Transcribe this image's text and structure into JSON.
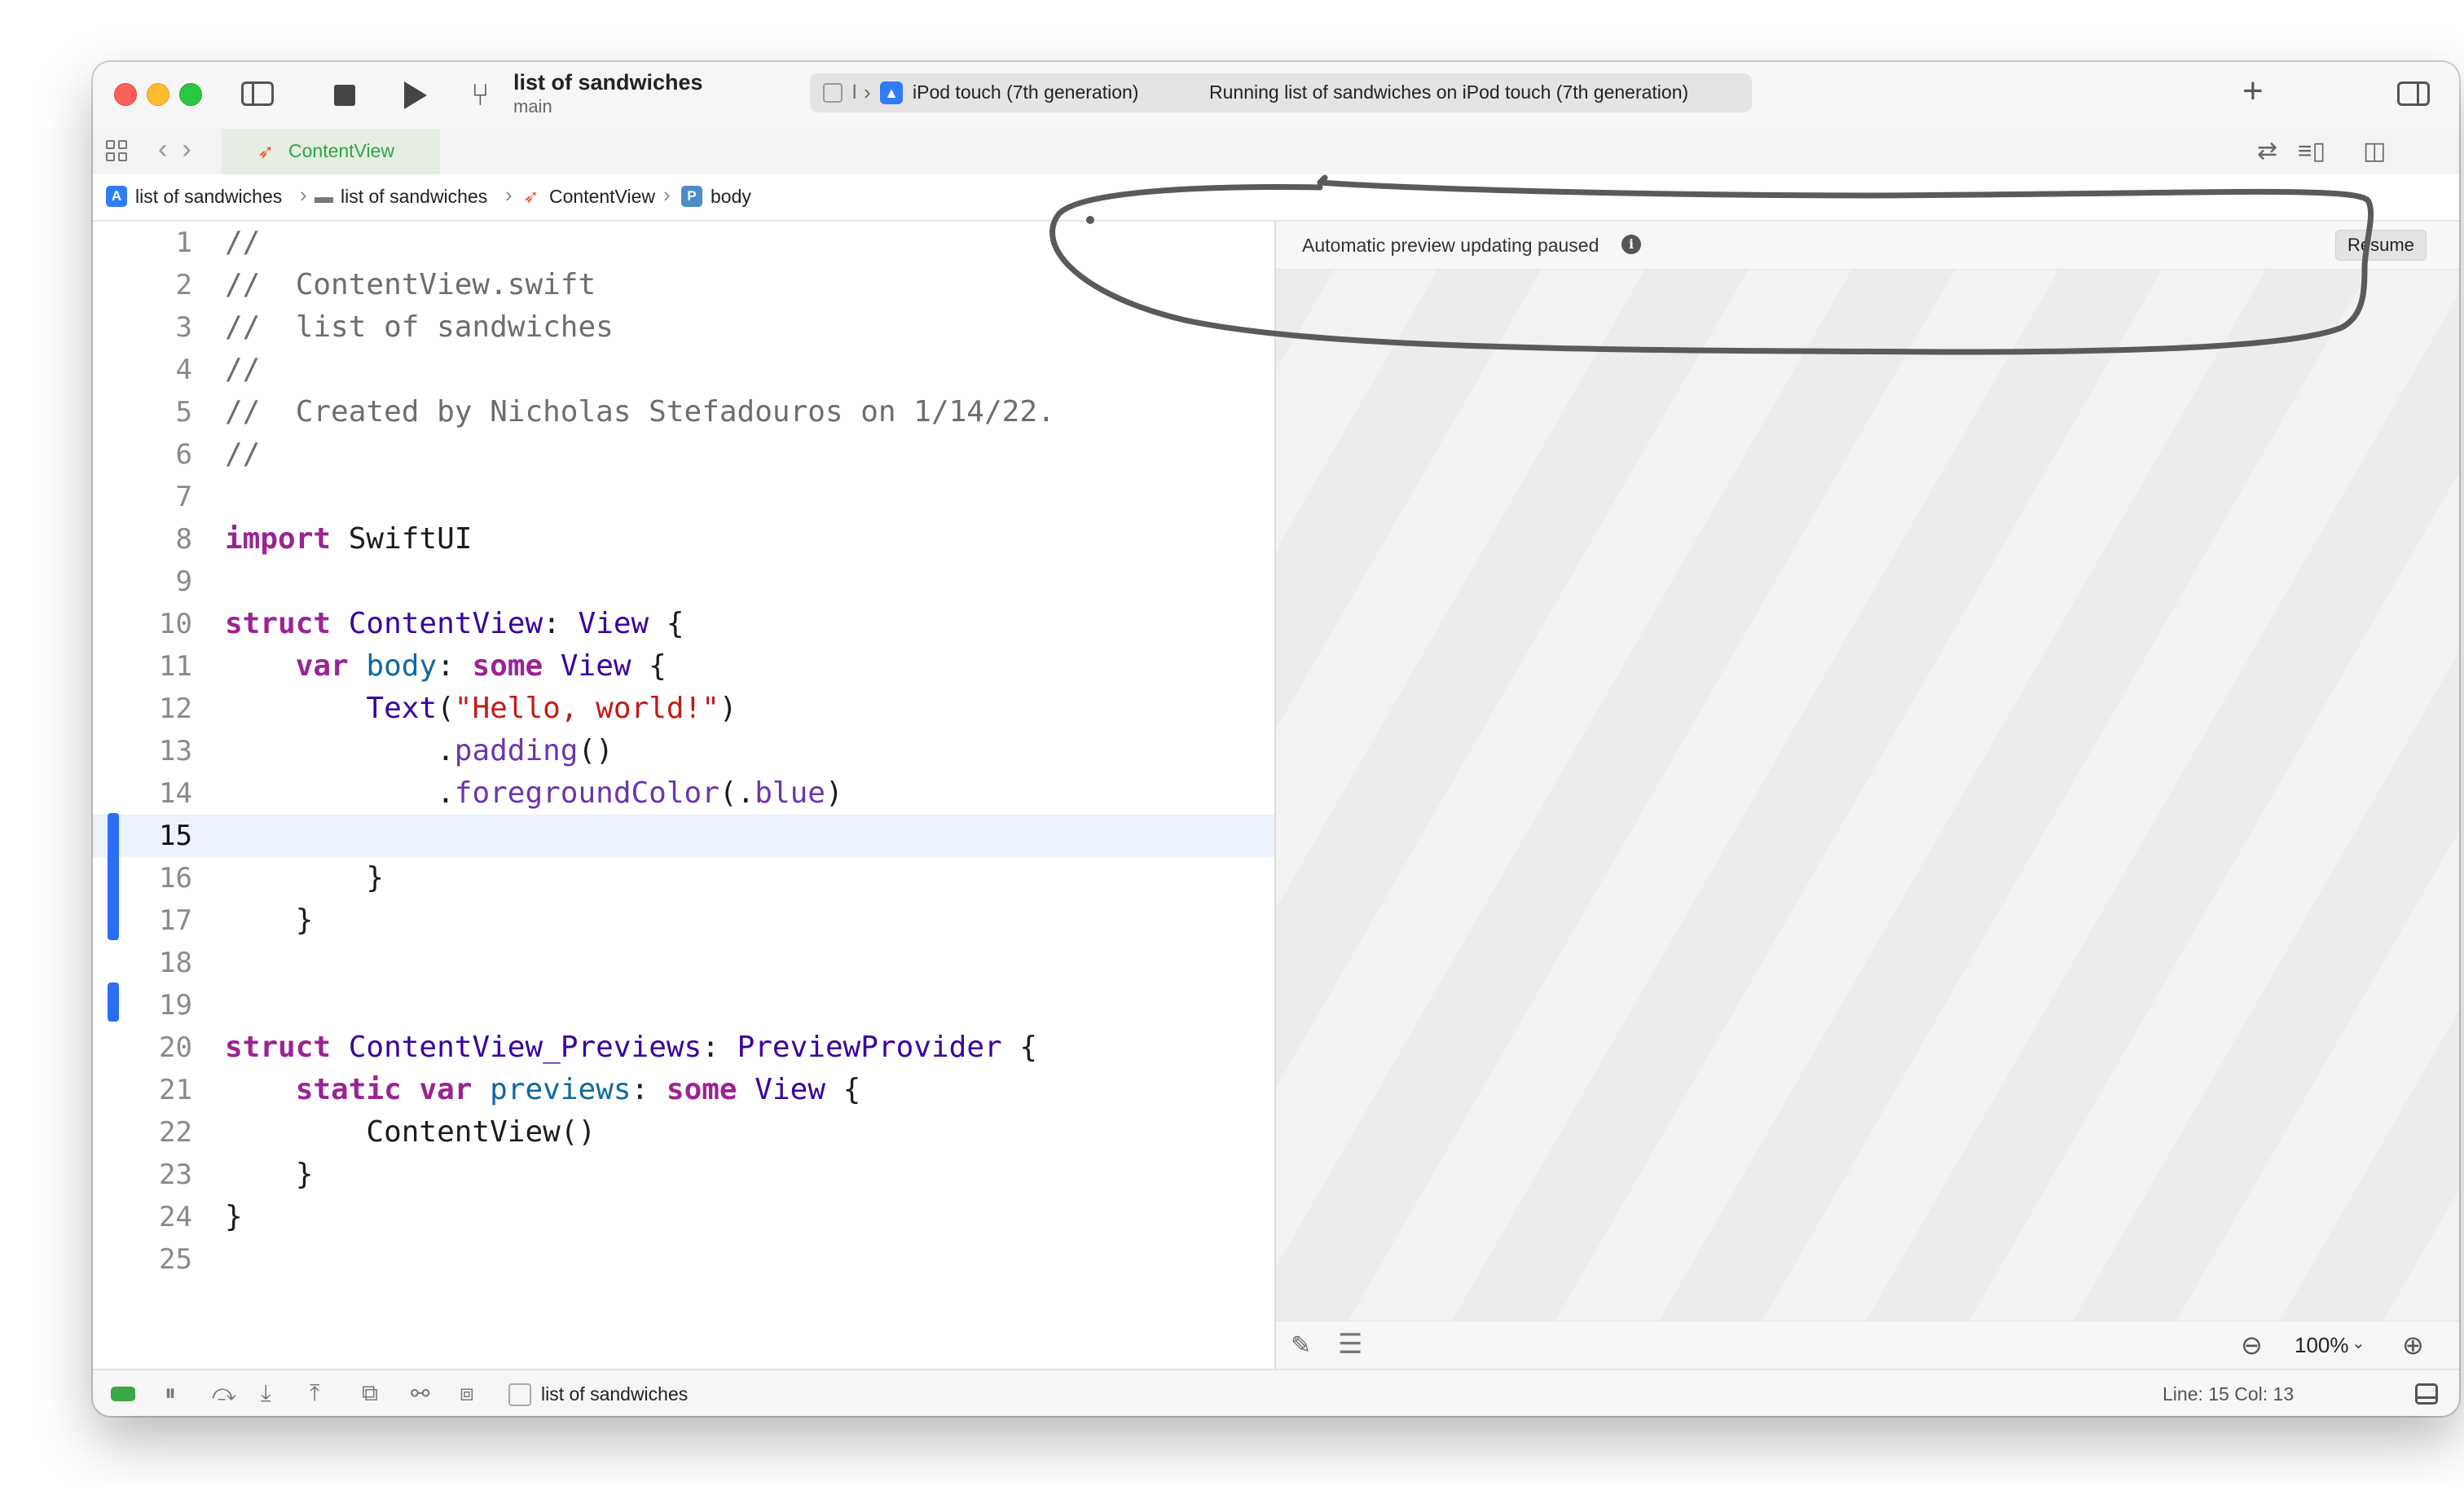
{
  "window": {
    "project_title": "list of sandwiches",
    "branch": "main",
    "scheme_separator": "l",
    "device": "iPod touch (7th generation)",
    "run_status": "Running list of sandwiches on iPod touch (7th generation)"
  },
  "tabs": [
    {
      "label": "ContentView",
      "active": true
    }
  ],
  "breadcrumb": [
    "list of sandwiches",
    "list of sandwiches",
    "ContentView",
    "body"
  ],
  "breadcrumb_badges": {
    "project": "A",
    "property": "P"
  },
  "editor": {
    "current_line": 15,
    "lines": [
      {
        "n": "1",
        "text": "//"
      },
      {
        "n": "2",
        "text": "//  ContentView.swift"
      },
      {
        "n": "3",
        "text": "//  list of sandwiches"
      },
      {
        "n": "4",
        "text": "//"
      },
      {
        "n": "5",
        "text": "//  Created by Nicholas Stefadouros on 1/14/22."
      },
      {
        "n": "6",
        "text": "//"
      },
      {
        "n": "7",
        "text": ""
      },
      {
        "n": "8",
        "text": "import SwiftUI"
      },
      {
        "n": "9",
        "text": ""
      },
      {
        "n": "10",
        "text": "struct ContentView: View {"
      },
      {
        "n": "11",
        "text": "    var body: some View {"
      },
      {
        "n": "12",
        "text": "        Text(\"Hello, world!\")"
      },
      {
        "n": "13",
        "text": "            .padding()"
      },
      {
        "n": "14",
        "text": "            .foregroundColor(.blue)"
      },
      {
        "n": "15",
        "text": ""
      },
      {
        "n": "16",
        "text": "        }"
      },
      {
        "n": "17",
        "text": "    }"
      },
      {
        "n": "18",
        "text": ""
      },
      {
        "n": "19",
        "text": ""
      },
      {
        "n": "20",
        "text": "struct ContentView_Previews: PreviewProvider {"
      },
      {
        "n": "21",
        "text": "    static var previews: some View {"
      },
      {
        "n": "22",
        "text": "        ContentView()"
      },
      {
        "n": "23",
        "text": "    }"
      },
      {
        "n": "24",
        "text": "}"
      },
      {
        "n": "25",
        "text": ""
      }
    ]
  },
  "preview": {
    "paused_message": "Automatic preview updating paused",
    "resume_label": "Resume",
    "zoom": "100%"
  },
  "statusbar": {
    "scheme": "list of sandwiches",
    "line_col": "Line: 15  Col: 13"
  },
  "colors": {
    "accent_blue": "#2a6ef5",
    "tab_green": "#2ea44f",
    "keyword": "#9b2393",
    "string": "#c41a16"
  }
}
